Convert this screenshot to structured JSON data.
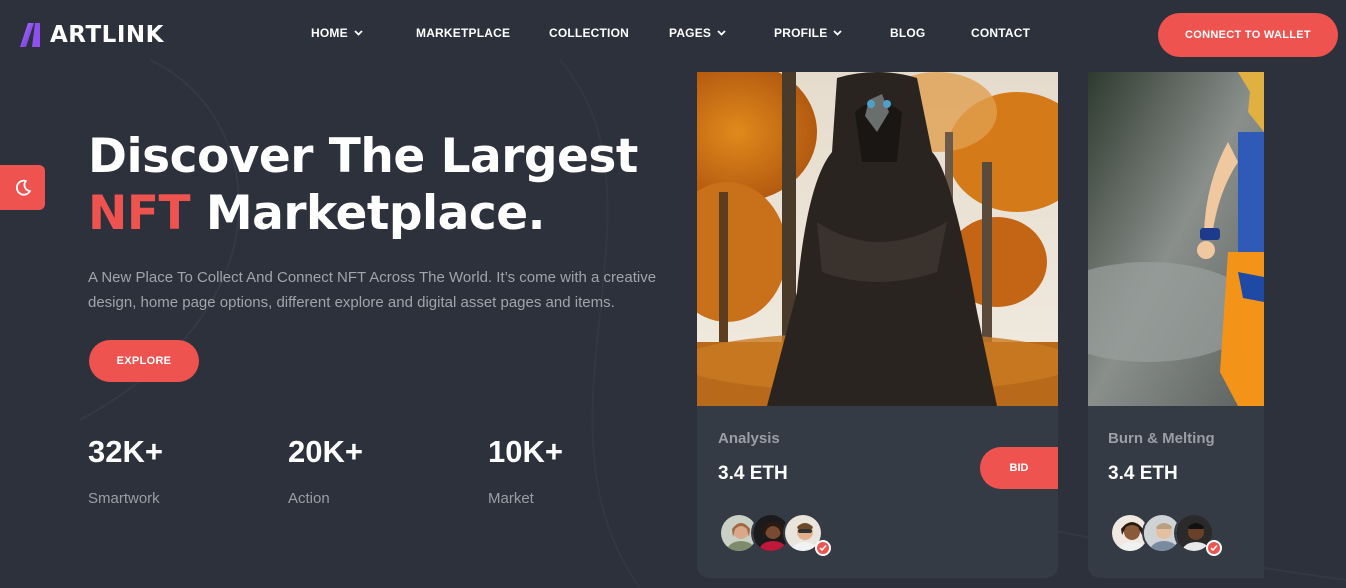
{
  "brand": {
    "name": "ARTLINK",
    "accent": "#ef5350",
    "background": "#2c313b"
  },
  "nav": {
    "items": [
      {
        "label": "HOME",
        "has_dropdown": true
      },
      {
        "label": "MARKETPLACE",
        "has_dropdown": false
      },
      {
        "label": "COLLECTION",
        "has_dropdown": false
      },
      {
        "label": "PAGES",
        "has_dropdown": true
      },
      {
        "label": "PROFILE",
        "has_dropdown": true
      },
      {
        "label": "BLOG",
        "has_dropdown": false
      },
      {
        "label": "CONTACT",
        "has_dropdown": false
      }
    ],
    "cta": "CONNECT TO WALLET"
  },
  "theme_toggle": {
    "icon": "moon-icon"
  },
  "hero": {
    "title_line1": "Discover The Largest",
    "title_accent": "NFT",
    "title_line2_rest": " Marketplace.",
    "description": "A New Place To Collect And Connect NFT Across The World. It’s come with a creative design, home page options, different explore and digital asset pages and items.",
    "button": "EXPLORE"
  },
  "stats": [
    {
      "value": "32K+",
      "label": "Smartwork"
    },
    {
      "value": "20K+",
      "label": "Action"
    },
    {
      "value": "10K+",
      "label": "Market"
    }
  ],
  "cards": [
    {
      "name": "Analysis",
      "price": "3.4 ETH",
      "bid_label": "BID",
      "image": "hooded-figure-autumn-forest"
    },
    {
      "name": "Burn & Melting",
      "price": "3.4 ETH",
      "image": "action-figure-orange-outfit"
    }
  ]
}
